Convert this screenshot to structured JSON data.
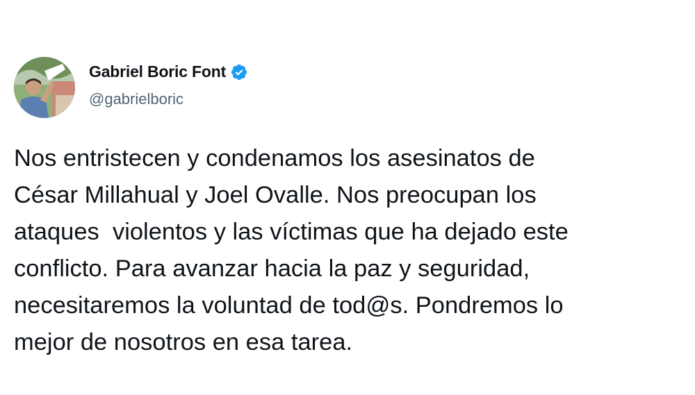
{
  "author": {
    "name": "Gabriel Boric Font",
    "handle": "@gabrielboric",
    "verified": true,
    "avatar_icon": "profile-photo",
    "verified_icon": "verified-badge-icon"
  },
  "tweet": {
    "lines": [
      "Nos entristecen y condenamos los asesinatos de",
      "César Millahual y Joel Ovalle. Nos preocupan los",
      "ataques  violentos y las víctimas que ha dejado este",
      "conflicto. Para avanzar hacia la paz y seguridad,",
      "necesitaremos la voluntad de tod@s. Pondremos lo",
      "mejor de nosotros en esa tarea."
    ]
  },
  "colors": {
    "background": "#ffffff",
    "text": "#0f1419",
    "secondary_text": "#536471",
    "verified_blue": "#1d9bf0"
  }
}
